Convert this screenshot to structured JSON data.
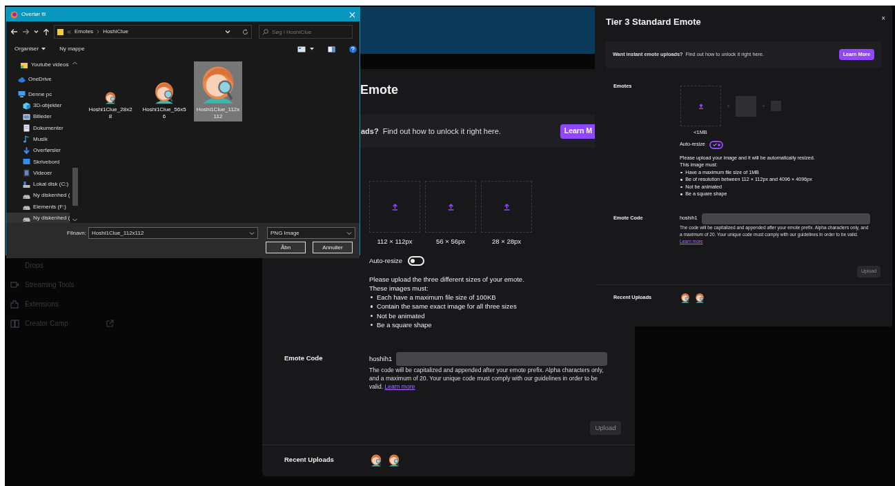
{
  "background_page": {
    "sidebar_items": [
      {
        "label": "Drops",
        "kind": "none"
      },
      {
        "label": "Streaming Tools",
        "kind": "camera"
      },
      {
        "label": "Extensions",
        "kind": "puzzle"
      },
      {
        "label": "Creator Camp",
        "kind": "book",
        "external": true
      }
    ]
  },
  "standard_dialog": {
    "title": "Emote",
    "banner": {
      "question": "ads?",
      "text": "Find out how to unlock it right here.",
      "button": "Learn M"
    },
    "emote_sizes": [
      "112 × 112px",
      "56 × 56px",
      "28 × 28px"
    ],
    "auto_resize": {
      "label": "Auto-resize",
      "on": false
    },
    "instructions": {
      "lines": [
        "Please upload the three different sizes of your emote.",
        "These images must:"
      ],
      "bullets": [
        "Each have a maximum file size of 100KB",
        "Contain the same exact image for all three sizes",
        "Not be animated",
        "Be a square shape"
      ]
    },
    "code_label": "Emote Code",
    "prefix": "hoshih1",
    "help": "The code will be capitalized and appended after your emote prefix. Alpha characters only, and a maximum of 20. Your unique code must comply with our guidelines in order to be valid.",
    "help_link": "Learn more",
    "upload_button": {
      "label": "Upload",
      "disabled": true
    },
    "recent_label": "Recent Uploads",
    "recent_uploads": [
      {
        "kind": "picture"
      },
      {
        "kind": "picture"
      }
    ]
  },
  "tier3_dialog": {
    "title": "Tier 3 Standard Emote",
    "close": "×",
    "banner": {
      "question": "Want instant emote uploads?",
      "text": "Find out how to unlock it right here.",
      "button": "Learn More"
    },
    "emotes_label": "Emotes",
    "size_note": "<1MB",
    "auto_resize": {
      "label": "Auto-resize",
      "on": true
    },
    "instructions": {
      "lines": [
        "Please upload your image and it will be automatically resized.",
        "This image must:"
      ],
      "bullets": [
        "Have a maximum file size of 1MB",
        "Be of resolution between 112 × 112px and 4096 × 4096px",
        "Not be animated",
        "Be a square shape"
      ]
    },
    "code_label": "Emote Code",
    "prefix": "hoshih1",
    "help": "The code will be capitalized and appended after your emote prefix. Alpha characters only, and a maximum of 20. Your unique code must comply with our guidelines in order to be valid.",
    "help_link": "Learn more",
    "upload_button": {
      "label": "Upload",
      "disabled": true
    },
    "recent_label": "Recent Uploads",
    "recent_uploads": [
      {
        "kind": "picture"
      },
      {
        "kind": "picture"
      }
    ]
  },
  "file_dialog": {
    "title": "Overfør fil",
    "breadcrumb": [
      "Emotes",
      "HoshiClue"
    ],
    "search": {
      "placeholder": "Søg i HoshiClue"
    },
    "toolbar": [
      {
        "label": "Organiser",
        "dropdown": true
      },
      {
        "label": "Ny mappe",
        "dropdown": false
      }
    ],
    "nav_items": [
      {
        "label": "Youtube videos",
        "kind": "folder",
        "selected": false
      },
      {
        "label": "OneDrive",
        "kind": "cloud",
        "selected": false
      },
      {
        "label": "Denne pc",
        "kind": "computer",
        "selected": false,
        "children": [
          {
            "label": "3D-objekter",
            "kind": "cube",
            "selected": false
          },
          {
            "label": "Billeder",
            "kind": "pictures",
            "selected": false
          },
          {
            "label": "Dokumenter",
            "kind": "document",
            "selected": false
          },
          {
            "label": "Musik",
            "kind": "music",
            "selected": false
          },
          {
            "label": "Overførsler",
            "kind": "download",
            "selected": false
          },
          {
            "label": "Skrivebord",
            "kind": "desktop",
            "selected": false
          },
          {
            "label": "Videoer",
            "kind": "video",
            "selected": false
          },
          {
            "label": "Lokal disk (C:)",
            "kind": "system",
            "selected": false
          },
          {
            "label": "Ny diskenhed (",
            "kind": "drive",
            "selected": false
          },
          {
            "label": "Elements (F:)",
            "kind": "drive",
            "selected": false
          },
          {
            "label": "Ny diskenhed (",
            "kind": "drive",
            "selected": true
          }
        ]
      }
    ],
    "files": [
      {
        "name": "Hoshi1Clue_28x28",
        "selected": false
      },
      {
        "name": "Hoshi1Clue_56x56",
        "selected": false
      },
      {
        "name": "Hoshi1Clue_112x112",
        "selected": true
      }
    ],
    "filename_label": "Filnavn:",
    "filename": "Hoshi1Clue_112x112",
    "filetype": "PNG Image",
    "buttons": [
      "Åbn",
      "Annuller"
    ]
  }
}
